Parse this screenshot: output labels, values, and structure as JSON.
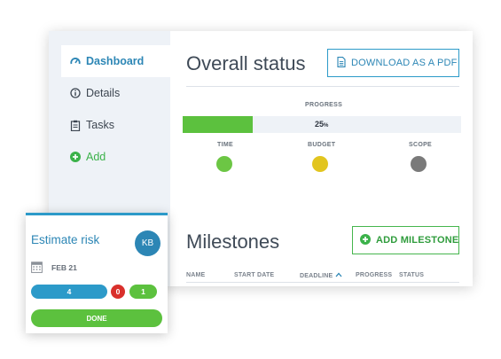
{
  "sidebar": {
    "items": [
      {
        "label": "Dashboard",
        "icon": "gauge-icon",
        "active": true
      },
      {
        "label": "Details",
        "icon": "info-icon"
      },
      {
        "label": "Tasks",
        "icon": "clipboard-icon"
      },
      {
        "label": "Add",
        "icon": "plus-circle-icon"
      }
    ]
  },
  "overview": {
    "title": "Overall status",
    "download_button": "DOWNLOAD AS A PDF",
    "progress_label": "PROGRESS",
    "progress_value": "25",
    "progress_unit": "%",
    "progress_fraction": 0.25,
    "indicators": [
      {
        "label": "TIME",
        "color": "#6cc644"
      },
      {
        "label": "BUDGET",
        "color": "#e2c51f"
      },
      {
        "label": "SCOPE",
        "color": "#7a7a7a"
      }
    ]
  },
  "milestones": {
    "title": "Milestones",
    "add_button": "ADD MILESTONE",
    "columns": [
      "NAME",
      "START DATE",
      "DEADLINE",
      "PROGRESS",
      "STATUS"
    ]
  },
  "task_card": {
    "title": "Estimate risk",
    "avatar_initials": "KB",
    "date": "FEB 21",
    "counts": {
      "blue": "4",
      "red": "0",
      "green": "1"
    },
    "done_label": "DONE"
  },
  "colors": {
    "accent_blue": "#2c9ac9",
    "accent_green": "#5cc13e",
    "danger_red": "#d9302c"
  }
}
